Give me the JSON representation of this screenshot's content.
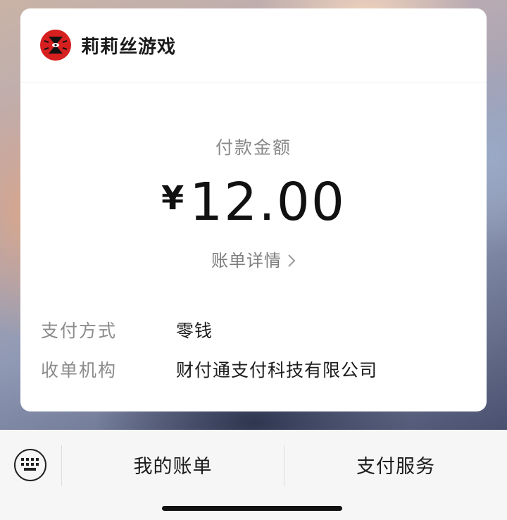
{
  "merchant": {
    "name": "莉莉丝游戏",
    "logo_icon": "lilith-logo-icon",
    "logo_color": "#d61f1f"
  },
  "payment": {
    "amount_label": "付款金额",
    "currency_symbol": "¥",
    "amount": "12.00",
    "bill_details_label": "账单详情",
    "bill_details_icon": "chevron-right-icon"
  },
  "details": [
    {
      "label": "支付方式",
      "value": "零钱"
    },
    {
      "label": "收单机构",
      "value": "财付通支付科技有限公司"
    }
  ],
  "bottom_menu": {
    "keyboard_icon": "keyboard-icon",
    "items": [
      {
        "label": "我的账单"
      },
      {
        "label": "支付服务"
      }
    ]
  }
}
